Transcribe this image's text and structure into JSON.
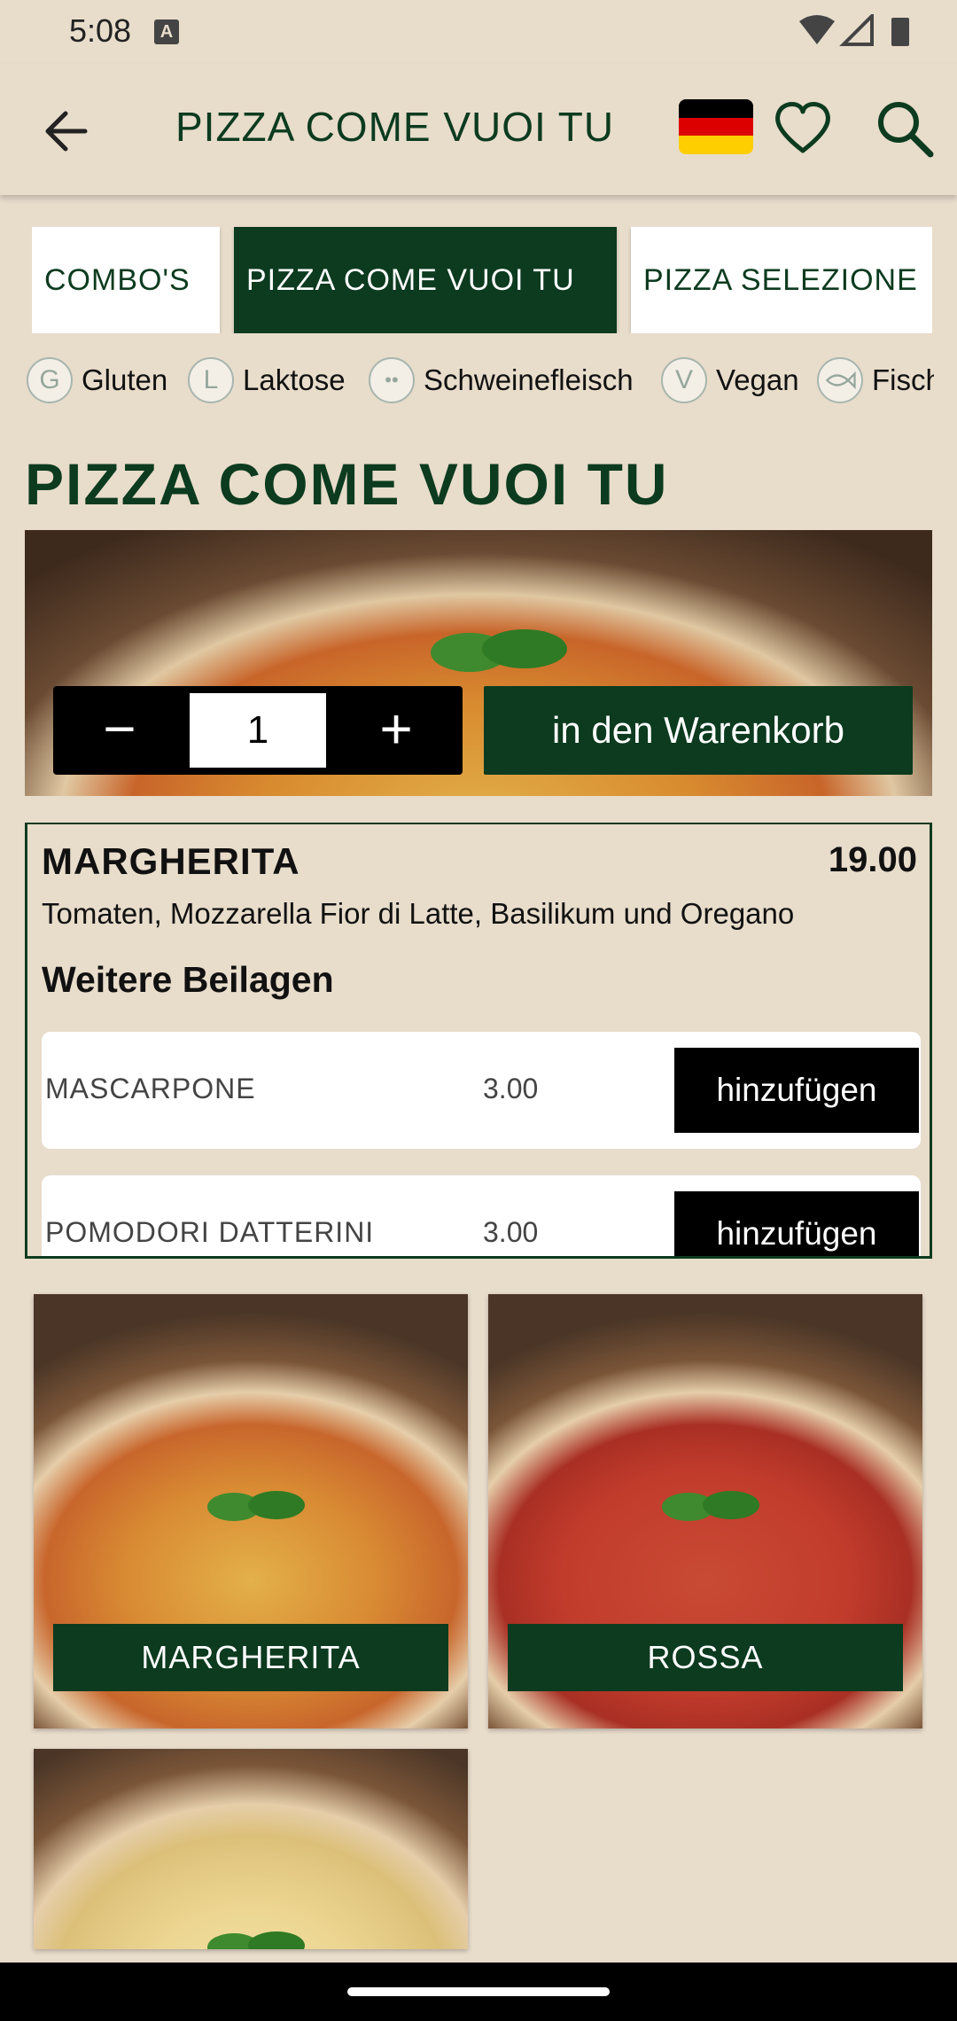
{
  "status_bar": {
    "time": "5:08",
    "notification_icon": "A"
  },
  "app_bar": {
    "title": "PIZZA COME VUOI TU",
    "icons": [
      "arrow-left-icon",
      "german-flag-icon",
      "heart-outline-icon",
      "search-icon"
    ],
    "flag_colors": [
      "#000000",
      "#dd0000",
      "#ffce00"
    ]
  },
  "tabs": [
    {
      "label": "COMBO'S",
      "active": false
    },
    {
      "label": "PIZZA COME VUOI TU",
      "active": true
    },
    {
      "label": "PIZZA SELEZIONE",
      "active": false
    }
  ],
  "legend": [
    {
      "badge": "G",
      "label": "Gluten"
    },
    {
      "badge": "L",
      "label": "Laktose"
    },
    {
      "badge": "••",
      "label": "Schweinefleisch"
    },
    {
      "badge": "V",
      "label": "Vegan"
    },
    {
      "badge": "fish",
      "label": "Fisch"
    }
  ],
  "section_title": "PIZZA COME VUOI TU",
  "hero": {
    "qty_minus": "−",
    "qty_value": "1",
    "qty_plus": "+",
    "add_to_cart": "in den Warenkorb"
  },
  "product": {
    "name": "MARGHERITA",
    "price": "19.00",
    "description": "Tomaten, Mozzarella Fior di Latte, Basilikum und Oregano",
    "extras_heading": "Weitere Beilagen",
    "extras": [
      {
        "name": "MASCARPONE",
        "price": "3.00",
        "button": "hinzufügen"
      },
      {
        "name": "POMODORI DATTERINI",
        "price": "3.00",
        "button": "hinzufügen"
      }
    ]
  },
  "grid": [
    {
      "label": "MARGHERITA"
    },
    {
      "label": "ROSSA"
    },
    {
      "label": ""
    }
  ],
  "colors": {
    "background": "#e8dccb",
    "brand_green": "#0c3b1f",
    "black": "#000000",
    "white": "#ffffff"
  }
}
